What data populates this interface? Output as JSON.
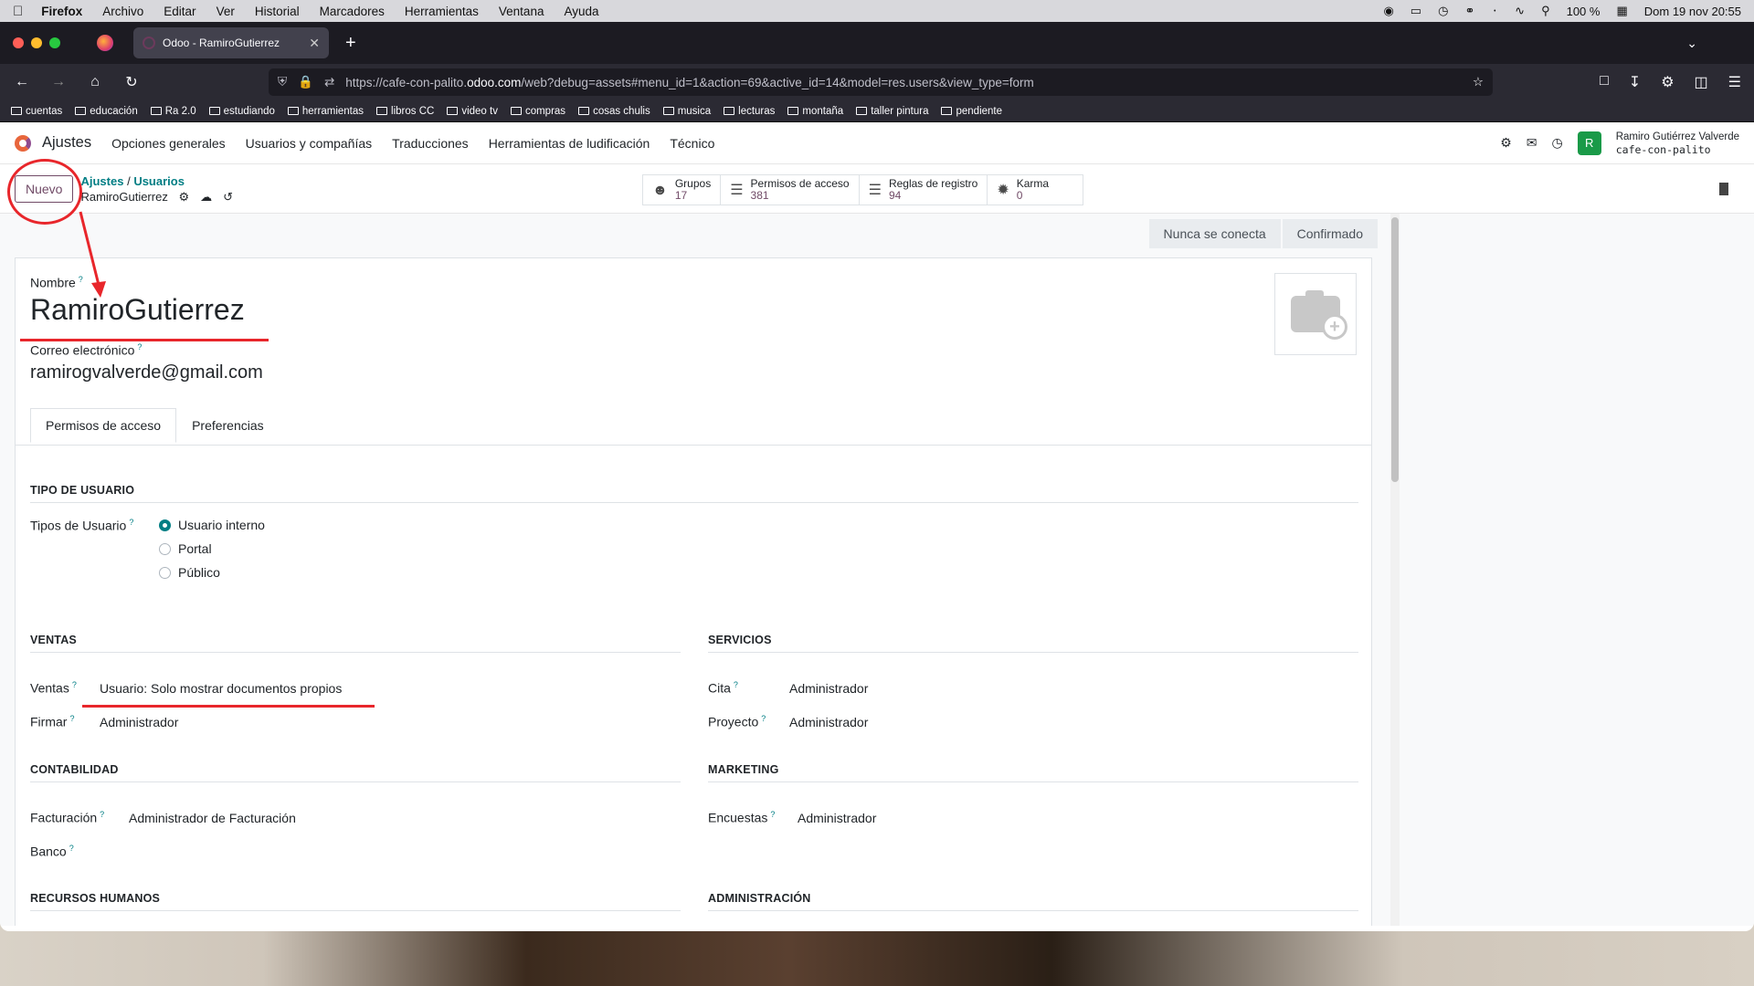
{
  "menubar": {
    "app": "Firefox",
    "items": [
      "Archivo",
      "Editar",
      "Ver",
      "Historial",
      "Marcadores",
      "Herramientas",
      "Ventana",
      "Ayuda"
    ],
    "battery": "100 %",
    "datetime": "Dom 19 nov  20:55"
  },
  "browser": {
    "tab_title": "Odoo - RamiroGutierrez",
    "url_prefix": "https://cafe-con-palito.",
    "url_host": "odoo.com",
    "url_path": "/web?debug=assets#menu_id=1&action=69&active_id=14&model=res.users&view_type=form"
  },
  "bookmarks": [
    "cuentas",
    "educación",
    "Ra 2.0",
    "estudiando",
    "herramientas",
    "libros CC",
    "video tv",
    "compras",
    "cosas chulis",
    "musica",
    "lecturas",
    "montaña",
    "taller pintura",
    "pendiente"
  ],
  "odoo": {
    "app_name": "Ajustes",
    "menu": [
      "Opciones generales",
      "Usuarios y compañías",
      "Traducciones",
      "Herramientas de ludificación",
      "Técnico"
    ],
    "user_name": "Ramiro Gutiérrez Valverde",
    "user_db": "cafe-con-palito",
    "avatar_letter": "R"
  },
  "control": {
    "new_label": "Nuevo",
    "crumb_root": "Ajustes",
    "crumb_sep": "/",
    "crumb_parent": "Usuarios",
    "crumb_current": "RamiroGutierrez"
  },
  "smart_buttons": [
    {
      "label": "Grupos",
      "value": "17"
    },
    {
      "label": "Permisos de acceso",
      "value": "381"
    },
    {
      "label": "Reglas de registro",
      "value": "94"
    },
    {
      "label": "Karma",
      "value": "0"
    }
  ],
  "status": [
    "Nunca se conecta",
    "Confirmado"
  ],
  "form": {
    "name_label": "Nombre",
    "name_value": "RamiroGutierrez",
    "email_label": "Correo electrónico",
    "email_value": "ramirogvalverde@gmail.com",
    "tabs": [
      "Permisos de acceso",
      "Preferencias"
    ],
    "user_type_section": "TIPO DE USUARIO",
    "user_type_label": "Tipos de Usuario",
    "user_types": [
      "Usuario interno",
      "Portal",
      "Público"
    ],
    "sections": {
      "ventas": "VENTAS",
      "servicios": "SERVICIOS",
      "contabilidad": "CONTABILIDAD",
      "marketing": "MARKETING",
      "rrhh": "RECURSOS HUMANOS",
      "admin": "ADMINISTRACIÓN"
    },
    "fields": {
      "ventas_label": "Ventas",
      "ventas_value": "Usuario: Solo mostrar documentos propios",
      "firmar_label": "Firmar",
      "firmar_value": "Administrador",
      "cita_label": "Cita",
      "cita_value": "Administrador",
      "proyecto_label": "Proyecto",
      "proyecto_value": "Administrador",
      "facturacion_label": "Facturación",
      "facturacion_value": "Administrador de Facturación",
      "banco_label": "Banco",
      "encuestas_label": "Encuestas",
      "encuestas_value": "Administrador"
    },
    "help_mark": "?"
  },
  "colors": {
    "odoo_primary": "#714b67",
    "odoo_link": "#017e84",
    "annotation": "#e8262b"
  }
}
